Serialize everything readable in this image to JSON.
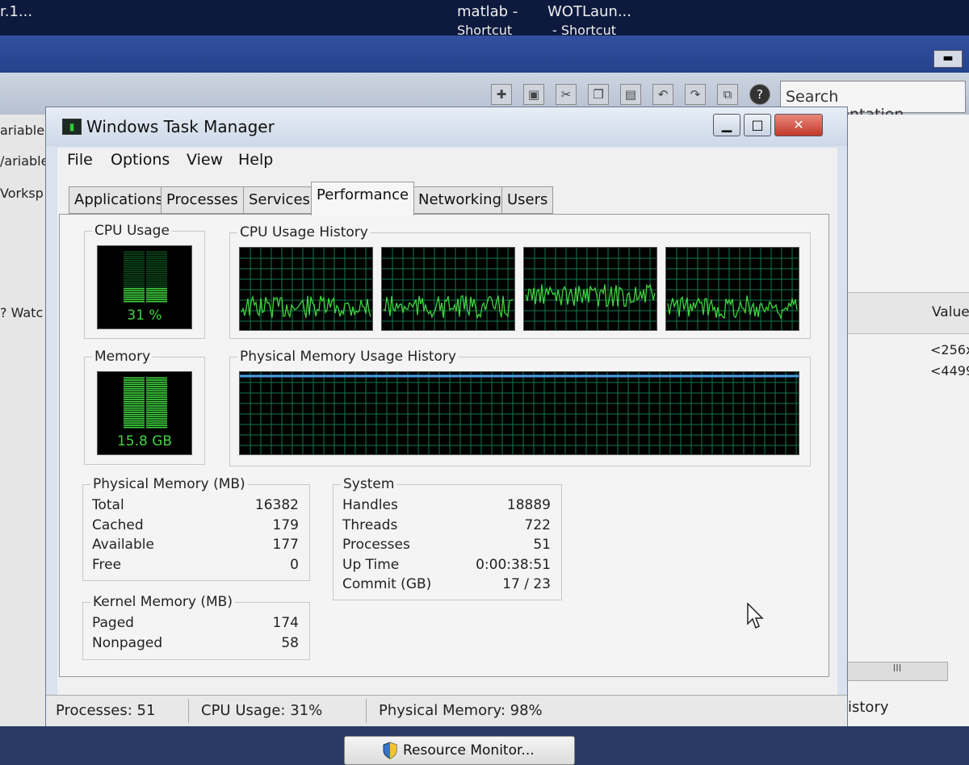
{
  "desktop": {
    "icons": [
      {
        "label": "r.1...",
        "sub": ""
      },
      {
        "label": "matlab -",
        "sub": "Shortcut"
      },
      {
        "label": "WOTLaun...",
        "sub": "- Shortcut"
      }
    ]
  },
  "matlab": {
    "search_placeholder": "Search Documentation",
    "left_items": [
      "ariable",
      "/ariable",
      "Vorksp",
      "? Watc"
    ],
    "right_header": "Value",
    "right_values": [
      "<256x",
      "<4499"
    ],
    "right_footer": "istory",
    "scroll_grip": "III"
  },
  "window": {
    "title": "Windows Task Manager",
    "colors": {
      "graph_bg": "#000000",
      "graph_line": "#3fd43f",
      "mem_line": "#4a9fe8",
      "grid": "#0f7a4a"
    }
  },
  "menu": [
    "File",
    "Options",
    "View",
    "Help"
  ],
  "tabs": [
    "Applications",
    "Processes",
    "Services",
    "Performance",
    "Networking",
    "Users"
  ],
  "active_tab": "Performance",
  "performance": {
    "cpu_usage_label": "CPU Usage",
    "cpu_usage_value": "31 %",
    "cpu_usage_fraction": 0.31,
    "cpu_history_label": "CPU Usage History",
    "cpu_cores": 4,
    "memory_label": "Memory",
    "memory_value": "15.8 GB",
    "memory_fraction": 0.98,
    "mem_history_label": "Physical Memory Usage History",
    "physical_memory": {
      "label": "Physical Memory (MB)",
      "rows": [
        {
          "label": "Total",
          "value": "16382"
        },
        {
          "label": "Cached",
          "value": "179"
        },
        {
          "label": "Available",
          "value": "177"
        },
        {
          "label": "Free",
          "value": "0"
        }
      ]
    },
    "kernel_memory": {
      "label": "Kernel Memory (MB)",
      "rows": [
        {
          "label": "Paged",
          "value": "174"
        },
        {
          "label": "Nonpaged",
          "value": "58"
        }
      ]
    },
    "system": {
      "label": "System",
      "rows": [
        {
          "label": "Handles",
          "value": "18889"
        },
        {
          "label": "Threads",
          "value": "722"
        },
        {
          "label": "Processes",
          "value": "51"
        },
        {
          "label": "Up Time",
          "value": "0:00:38:51"
        },
        {
          "label": "Commit (GB)",
          "value": "17 / 23"
        }
      ]
    },
    "resource_monitor_label": "Resource Monitor..."
  },
  "status": {
    "processes": "Processes: 51",
    "cpu": "CPU Usage: 31%",
    "memory": "Physical Memory: 98%"
  }
}
